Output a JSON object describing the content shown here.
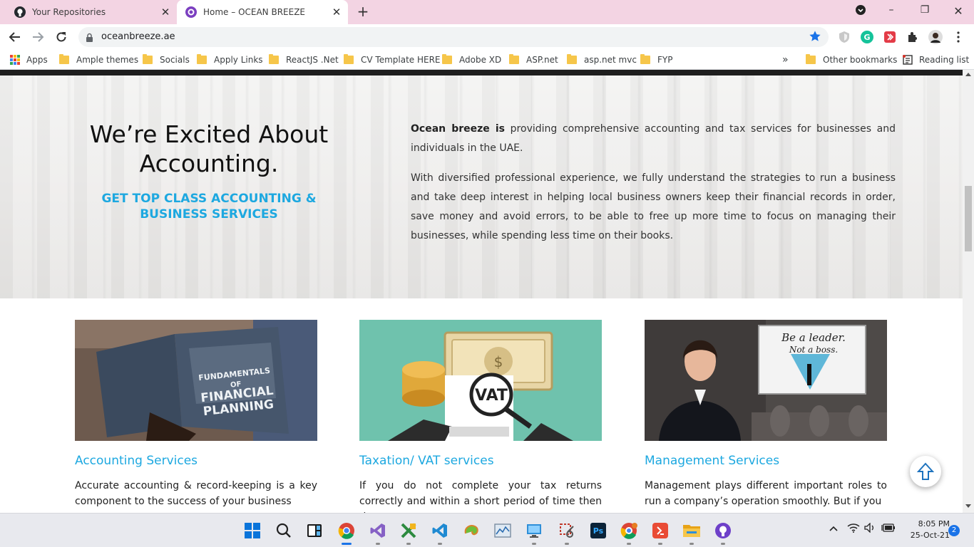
{
  "browser": {
    "tabs": [
      {
        "title": "Your Repositories",
        "icon": "github-icon"
      },
      {
        "title": "Home – OCEAN BREEZE",
        "icon": "ocean-breeze-favicon"
      }
    ],
    "url": "oceanbreeze.ae",
    "bookmarks": [
      "Apps",
      "Ample themes",
      "Socials",
      "Apply Links",
      "ReactJS .Net",
      "CV Template HERE",
      "Adobe XD",
      "ASP.net",
      "asp.net mvc",
      "FYP"
    ],
    "other_bookmarks": "Other bookmarks",
    "reading_list": "Reading list",
    "overflow": "»"
  },
  "hero": {
    "title": "We’re Excited About Accounting.",
    "subtitle": "GET TOP CLASS ACCOUNTING & BUSINESS SERVICES",
    "brand": "Ocean breeze is",
    "para1_rest": " providing comprehensive accounting and tax services for businesses and individuals in the UAE.",
    "para2": "With diversified professional experience, we fully understand the strategies to run a business and take deep interest in helping local business owners keep their financial records in order, save money and avoid errors, to be able to free up more time to focus on managing their businesses, while spending less time on their books."
  },
  "services": [
    {
      "title": "Accounting Services",
      "text": "Accurate accounting & record-keeping is a key component to the success of your business",
      "image_text": "FUNDAMENTALS OF FINANCIAL PLANNING"
    },
    {
      "title": "Taxation/ VAT services",
      "text": "If you do not complete your tax returns correctly and within a short period of time then they may",
      "image_text": "VAT"
    },
    {
      "title": "Management Services",
      "text": "Management plays different important roles to run a company’s operation smoothly. But if you",
      "image_text": "Be a leader. Not a boss."
    }
  ],
  "taskbar": {
    "time": "8:05 PM",
    "date": "25-Oct-21",
    "notifications": "2"
  },
  "colors": {
    "accent": "#1da8e0",
    "tabstrip": "#f3d4e3",
    "taskbar": "#e8e9ee"
  }
}
